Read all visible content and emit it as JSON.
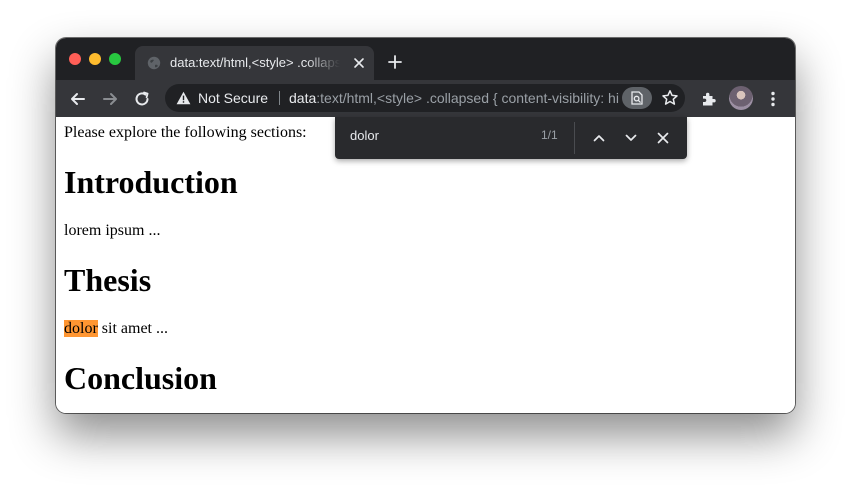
{
  "browser": {
    "tab": {
      "title": "data:text/html,<style> .collapsed { content-visibility: hidden; } </style>"
    },
    "address_bar": {
      "security_label": "Not Secure",
      "url_scheme": "data",
      "url_rest": ":text/html,<style> .collapsed { content-visibility: hidden; } </style>"
    },
    "icons": {
      "favicon": "globe-icon",
      "back": "back-arrow-icon",
      "forward": "forward-arrow-icon",
      "reload": "reload-icon",
      "warning": "warning-triangle-icon",
      "find": "find-in-page-icon",
      "bookmark": "star-icon",
      "extensions": "puzzle-icon",
      "profile": "avatar",
      "menu": "kebab-menu-icon"
    }
  },
  "find_bar": {
    "query": "dolor",
    "count": "1/1"
  },
  "page": {
    "intro_text": "Please explore the following sections:",
    "sections": [
      {
        "heading": "Introduction",
        "body": "lorem ipsum ..."
      },
      {
        "heading": "Thesis",
        "body_match": "dolor",
        "body_rest": " sit amet ..."
      },
      {
        "heading": "Conclusion"
      }
    ]
  },
  "colors": {
    "titlebar": "#202124",
    "toolbar": "#35363a",
    "omnibox": "#202124",
    "findbar": "#292a2d",
    "match_highlight": "#ff9632"
  }
}
